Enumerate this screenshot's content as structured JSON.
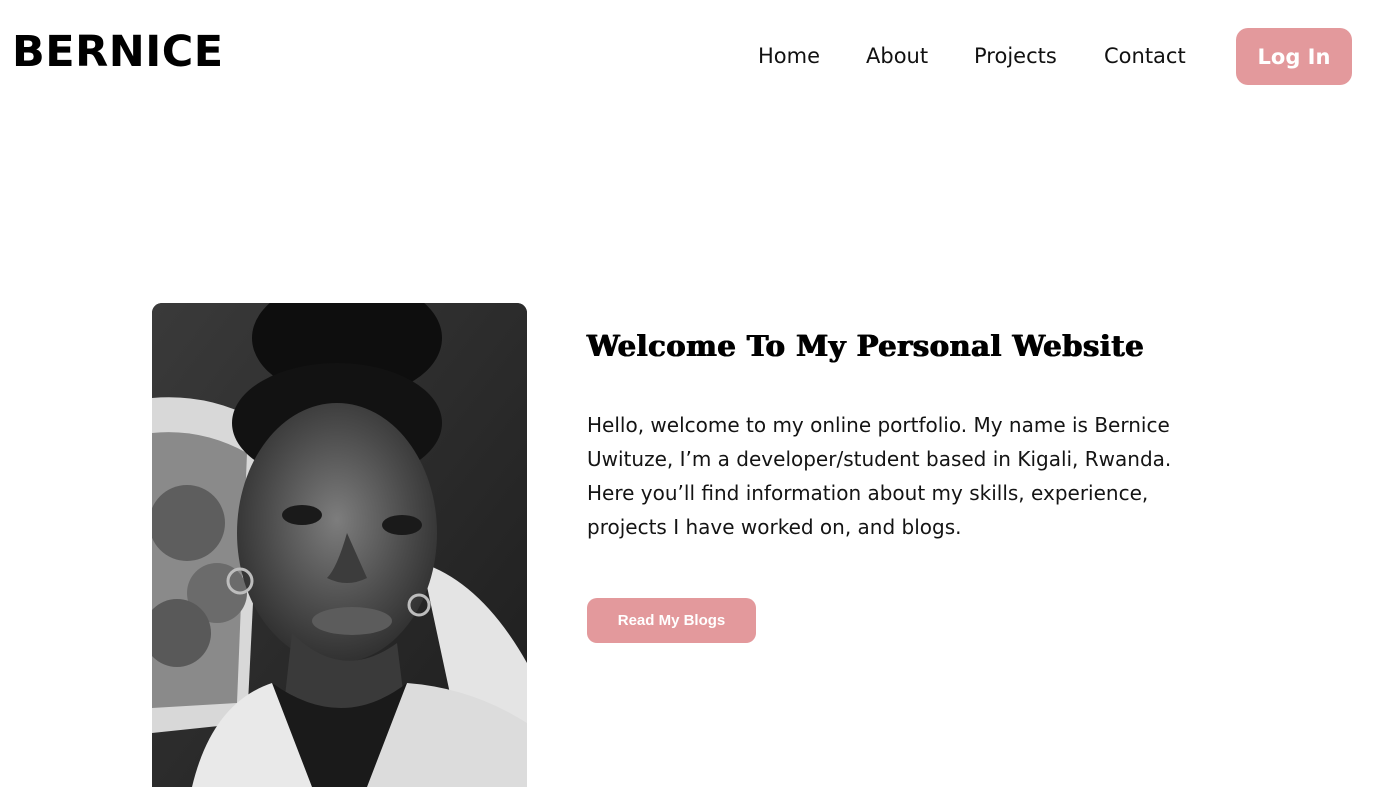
{
  "header": {
    "logo": "BERNICE",
    "nav": {
      "home": "Home",
      "about": "About",
      "projects": "Projects",
      "contact": "Contact"
    },
    "login_label": "Log In"
  },
  "hero": {
    "title": "Welcome To My Personal Website",
    "paragraph_1": "Hello, welcome to my online portfolio. My name is Bernice Uwituze, I’m a developer/student based in Kigali, Rwanda.",
    "paragraph_2": "Here you’ll find information about my skills, experience, projects I have worked on, and blogs.",
    "button_label": "Read My Blogs"
  },
  "colors": {
    "accent": "#e3999c",
    "text": "#0b0b0b",
    "background": "#ffffff"
  }
}
